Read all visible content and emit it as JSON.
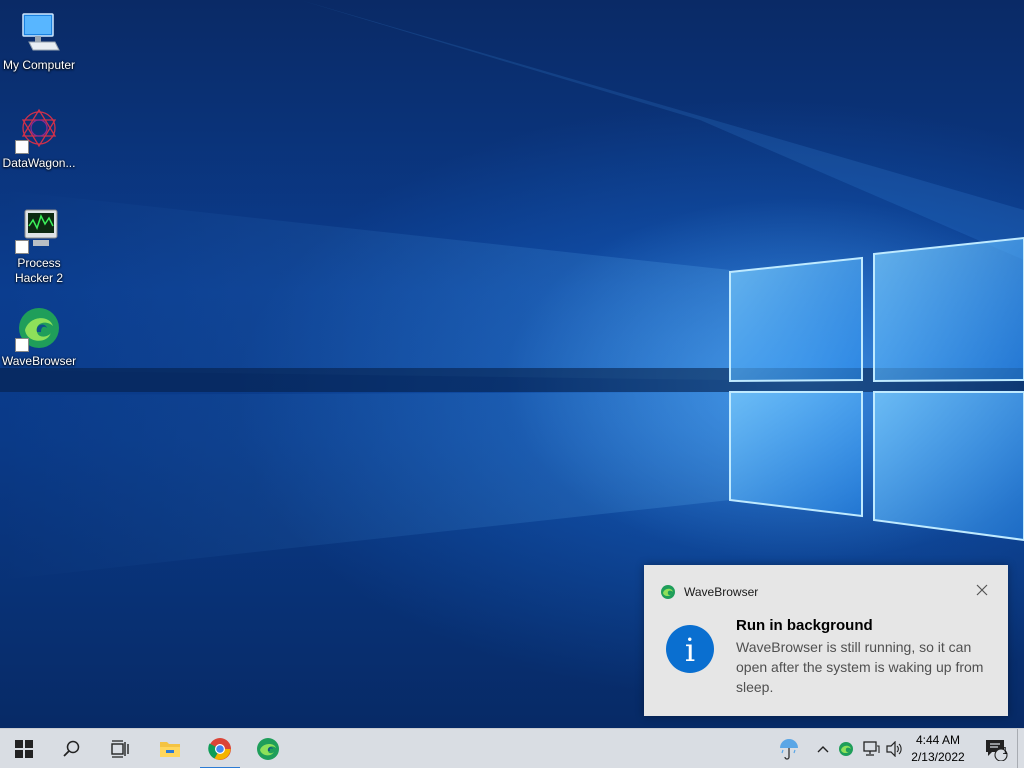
{
  "desktop": {
    "icons": [
      {
        "label": "My Computer",
        "icon": "computer-icon"
      },
      {
        "label": "DataWagon...",
        "icon": "datawagon-icon"
      },
      {
        "label": "Process Hacker 2",
        "icon": "process-hacker-icon"
      },
      {
        "label": "WaveBrowser",
        "icon": "wavebrowser-icon"
      }
    ]
  },
  "toast": {
    "app_name": "WaveBrowser",
    "app_icon": "wavebrowser-icon",
    "title": "Run in background",
    "body": "WaveBrowser is still running, so it can open after the system is waking up from sleep.",
    "info_glyph": "i",
    "close_icon": "close-icon"
  },
  "taskbar": {
    "pinned": [
      {
        "name": "start-button",
        "icon": "windows-logo-icon"
      },
      {
        "name": "search-button",
        "icon": "search-icon"
      },
      {
        "name": "task-view-button",
        "icon": "task-view-icon"
      },
      {
        "name": "file-explorer-button",
        "icon": "folder-icon"
      },
      {
        "name": "chrome-button",
        "icon": "chrome-icon"
      },
      {
        "name": "wavebrowser-button",
        "icon": "wavebrowser-icon"
      }
    ],
    "tray": {
      "time": "4:44 AM",
      "date": "2/13/2022",
      "notification_count": "1"
    }
  },
  "colors": {
    "accent": "#0a6fd0",
    "taskbar": "#d9dde3",
    "toast_bg": "#e6e6e6",
    "wallpaper": "#0b3d8f"
  }
}
